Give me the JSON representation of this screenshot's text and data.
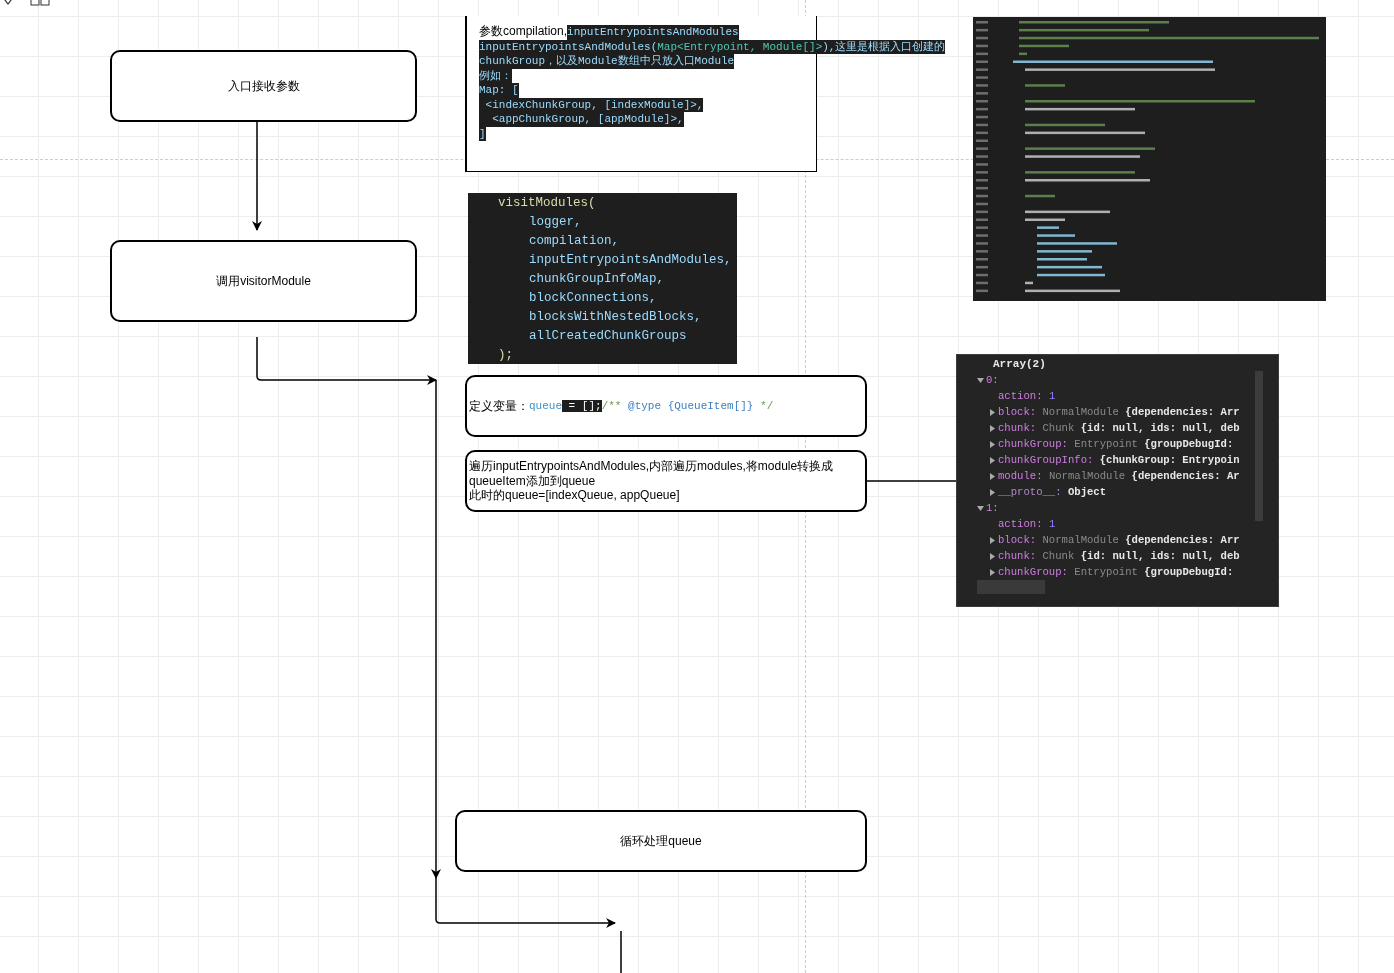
{
  "flow_nodes": [
    {
      "text": "入口接收参数"
    },
    {
      "text": "调用visitorModule"
    },
    {
      "text": "循环处理queue"
    }
  ],
  "note": {
    "lines": [
      {
        "segments": [
          {
            "text": "参数compilation,",
            "kind": "plain"
          },
          {
            "text": "inputEntrypointsAndModules",
            "kind": "code"
          }
        ]
      },
      {
        "segments": [
          {
            "text": "inputEntrypointsAndModules(",
            "kind": "code"
          },
          {
            "text": "Map<Entrypoint, Module[]>",
            "kind": "type"
          },
          {
            "text": "),这里是根据入口创建的",
            "kind": "code"
          }
        ]
      },
      {
        "segments": [
          {
            "text": "chunkGroup，以及Module数组中只放入口Module",
            "kind": "code"
          }
        ]
      },
      {
        "segments": [
          {
            "text": "例如：",
            "kind": "code"
          }
        ]
      },
      {
        "segments": [
          {
            "text": "Map: [",
            "kind": "code"
          }
        ]
      },
      {
        "segments": [
          {
            "text": " <indexChunkGroup, [indexModule]>,",
            "kind": "code"
          }
        ]
      },
      {
        "segments": [
          {
            "text": "  <appChunkGroup, [appModule]>,",
            "kind": "code"
          }
        ]
      },
      {
        "segments": [
          {
            "text": "]",
            "kind": "code"
          }
        ]
      }
    ]
  },
  "visit_call": {
    "open": "visitModules(",
    "args": [
      "logger,",
      "compilation,",
      "inputEntrypointsAndModules,",
      "chunkGroupInfoMap,",
      "blockConnections,",
      "blocksWithNestedBlocks,",
      "allCreatedChunkGroups"
    ],
    "close": ");"
  },
  "define_node": {
    "label": "定义变量：",
    "segments": [
      {
        "text": "queue",
        "kind": "variable"
      },
      {
        "text": " = [];",
        "kind": "selected"
      },
      {
        "text": "/** ",
        "kind": "comment"
      },
      {
        "text": "@type {QueueItem[]}",
        "kind": "tag"
      },
      {
        "text": " */",
        "kind": "comment"
      }
    ]
  },
  "iterate_node": {
    "lines": [
      "遍历inputEntrypointsAndModules,内部遍历modules,将module转换成",
      "queueItem添加到queue",
      "此时的queue=[indexQueue, appQueue]"
    ]
  },
  "console": {
    "title": "Array(2)",
    "items": [
      {
        "key": "0:",
        "expanded": true,
        "children": [
          {
            "key": "action:",
            "value": "1",
            "kind": "number"
          },
          {
            "key": "block:",
            "type": "NormalModule",
            "value": "{dependencies: Arr",
            "kind": "object",
            "expanded": false
          },
          {
            "key": "chunk:",
            "type": "Chunk",
            "value": "{id: null, ids: null, deb",
            "kind": "object",
            "expanded": false
          },
          {
            "key": "chunkGroup:",
            "type": "Entrypoint",
            "value": "{groupDebugId:",
            "kind": "object",
            "expanded": false
          },
          {
            "key": "chunkGroupInfo:",
            "value": "{chunkGroup: Entrypoin",
            "kind": "object",
            "expanded": false
          },
          {
            "key": "module:",
            "type": "NormalModule",
            "value": "{dependencies: Ar",
            "kind": "object",
            "expanded": false
          },
          {
            "key": "__proto__:",
            "value": "Object",
            "kind": "proto",
            "expanded": false
          }
        ]
      },
      {
        "key": "1:",
        "expanded": true,
        "children": [
          {
            "key": "action:",
            "value": "1",
            "kind": "number"
          },
          {
            "key": "block:",
            "type": "NormalModule",
            "value": "{dependencies: Arr",
            "kind": "object",
            "expanded": false
          },
          {
            "key": "chunk:",
            "type": "Chunk",
            "value": "{id: null, ids: null, deb",
            "kind": "object",
            "expanded": false
          },
          {
            "key": "chunkGroup:",
            "type": "Entrypoint",
            "value": "{groupDebugId:",
            "kind": "object",
            "expanded": false
          }
        ]
      }
    ]
  }
}
